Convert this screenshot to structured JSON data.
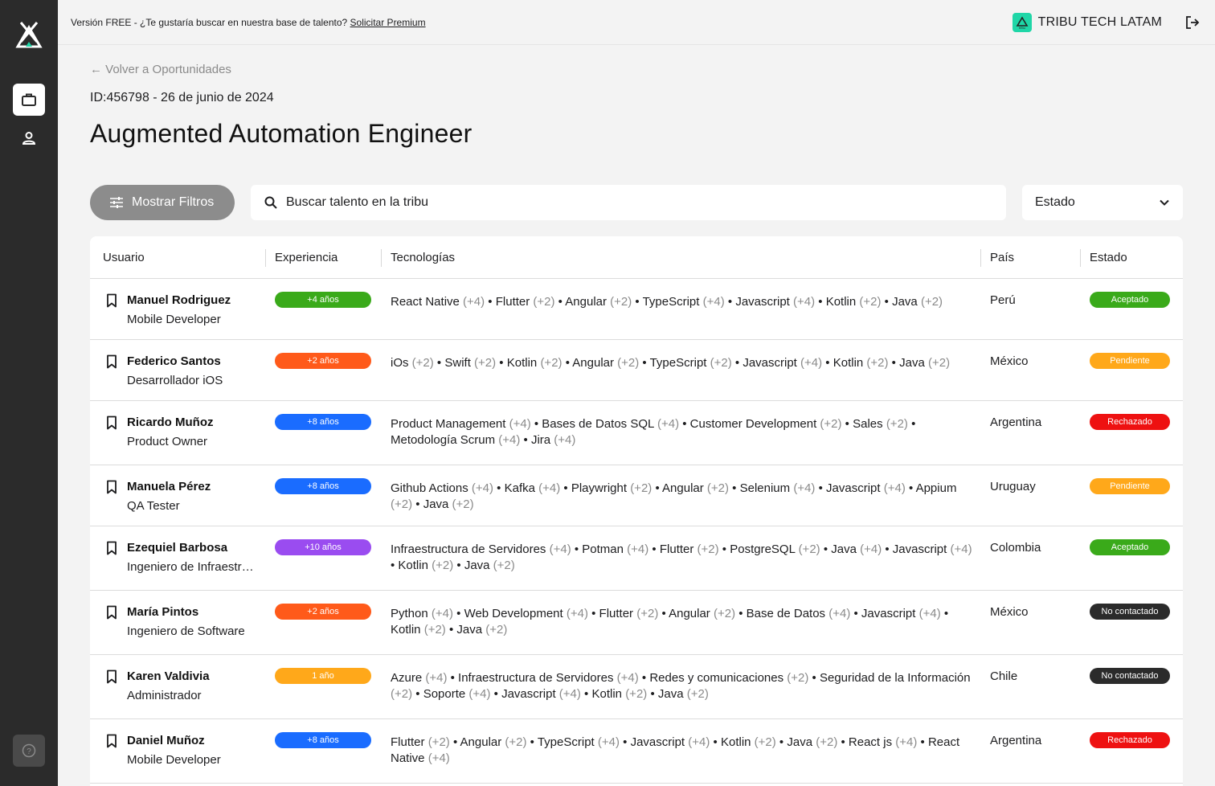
{
  "topbar": {
    "free_text": "Versión FREE - ¿Te gustaría buscar en nuestra base de talento?",
    "premium_link": "Solicitar Premium",
    "company": "TRIBU TECH LATAM",
    "brand_logo_text": "tribu"
  },
  "page": {
    "back_label": "← Volver a Oportunidades",
    "job_id": "ID:456798 - 26 de junio de 2024",
    "title": "Augmented Automation Engineer"
  },
  "toolbar": {
    "filter_label": "Mostrar Filtros",
    "search_placeholder": "Buscar talento en la tribu",
    "status_select": "Estado"
  },
  "table": {
    "headers": [
      "Usuario",
      "Experiencia",
      "Tecnologías",
      "País",
      "Estado"
    ],
    "rows": [
      {
        "name": "Manuel Rodriguez",
        "role": "Mobile Developer",
        "experience": "+4 años",
        "country": "Perú",
        "status": "Aceptado",
        "techs": [
          [
            "React Native",
            "(+4)"
          ],
          [
            "Flutter",
            "(+2)"
          ],
          [
            "Angular",
            "(+2)"
          ],
          [
            "TypeScript",
            "(+4)"
          ],
          [
            "Javascript",
            "(+4)"
          ],
          [
            "Kotlin",
            "(+2)"
          ],
          [
            "Java",
            "(+2)"
          ]
        ]
      },
      {
        "name": "Federico Santos",
        "role": "Desarrollador iOS",
        "experience": "+2 años",
        "country": "México",
        "status": "Pendiente",
        "techs": [
          [
            "iOs",
            "(+2)"
          ],
          [
            "Swift",
            "(+2)"
          ],
          [
            "Kotlin",
            "(+2)"
          ],
          [
            "Angular",
            "(+2)"
          ],
          [
            "TypeScript",
            "(+2)"
          ],
          [
            "Javascript",
            "(+4)"
          ],
          [
            "Kotlin",
            "(+2)"
          ],
          [
            "Java",
            "(+2)"
          ]
        ]
      },
      {
        "name": "Ricardo Muñoz",
        "role": "Product Owner",
        "experience": "+8 años",
        "country": "Argentina",
        "status": "Rechazado",
        "techs": [
          [
            "Product Management",
            "(+4)"
          ],
          [
            "Bases de Datos SQL",
            "(+4)"
          ],
          [
            "Customer Development",
            "(+2)"
          ],
          [
            "Sales",
            "(+2)"
          ],
          [
            "Metodología Scrum",
            "(+4)"
          ],
          [
            "Jira",
            "(+4)"
          ]
        ]
      },
      {
        "name": "Manuela Pérez",
        "role": "QA Tester",
        "experience": "+8 años",
        "country": "Uruguay",
        "status": "Pendiente",
        "techs": [
          [
            "Github Actions",
            "(+4)"
          ],
          [
            "Kafka",
            "(+4)"
          ],
          [
            "Playwright",
            "(+2)"
          ],
          [
            "Angular",
            "(+2)"
          ],
          [
            "Selenium",
            "(+4)"
          ],
          [
            "Javascript",
            "(+4)"
          ],
          [
            "Appium",
            "(+2)"
          ],
          [
            "Java",
            "(+2)"
          ]
        ]
      },
      {
        "name": "Ezequiel Barbosa",
        "role": "Ingeniero de Infraestructura",
        "experience": "+10 años",
        "country": "Colombia",
        "status": "Aceptado",
        "techs": [
          [
            "Infraestructura de Servidores",
            "(+4)"
          ],
          [
            "Potman",
            "(+4)"
          ],
          [
            "Flutter",
            "(+2)"
          ],
          [
            "PostgreSQL",
            "(+2)"
          ],
          [
            "Java",
            "(+4)"
          ],
          [
            "Javascript",
            "(+4)"
          ],
          [
            "Kotlin",
            "(+2)"
          ],
          [
            "Java",
            "(+2)"
          ]
        ]
      },
      {
        "name": "María Pintos",
        "role": "Ingeniero de Software",
        "experience": "+2 años",
        "country": "México",
        "status": "No contactado",
        "techs": [
          [
            "Python",
            "(+4)"
          ],
          [
            "Web Development",
            "(+4)"
          ],
          [
            "Flutter",
            "(+2)"
          ],
          [
            "Angular",
            "(+2)"
          ],
          [
            "Base de Datos",
            "(+4)"
          ],
          [
            "Javascript",
            "(+4)"
          ],
          [
            "Kotlin",
            "(+2)"
          ],
          [
            "Java",
            "(+2)"
          ]
        ]
      },
      {
        "name": "Karen Valdivia",
        "role": "Administrador",
        "experience": "1 año",
        "country": "Chile",
        "status": "No contactado",
        "techs": [
          [
            "Azure",
            "(+4)"
          ],
          [
            "Infraestructura de Servidores",
            "(+4)"
          ],
          [
            "Redes y comunicaciones",
            "(+2)"
          ],
          [
            "Seguridad de la Información",
            "(+2)"
          ],
          [
            "Soporte",
            "(+4)"
          ],
          [
            "Javascript",
            "(+4)"
          ],
          [
            "Kotlin",
            "(+2)"
          ],
          [
            "Java",
            "(+2)"
          ]
        ]
      },
      {
        "name": "Daniel Muñoz",
        "role": "Mobile Developer",
        "experience": "+8 años",
        "country": "Argentina",
        "status": "Rechazado",
        "techs": [
          [
            "Flutter",
            "(+2)"
          ],
          [
            "Angular",
            "(+2)"
          ],
          [
            "TypeScript",
            "(+4)"
          ],
          [
            "Javascript",
            "(+4)"
          ],
          [
            "Kotlin",
            "(+2)"
          ],
          [
            "Java",
            "(+2)"
          ],
          [
            "React js",
            "(+4)"
          ],
          [
            "React Native",
            "(+4)"
          ]
        ]
      }
    ]
  },
  "colors": {
    "experience": {
      "+4 años": "#3aaa1a",
      "+2 años": "#ff5a1a",
      "+8 años": "#1a6cff",
      "+10 años": "#9a4cf0",
      "1 año": "#ffa81a"
    },
    "status": {
      "Aceptado": "#3aaa1a",
      "Pendiente": "#ffa81a",
      "Rechazado": "#ee1111",
      "No contactado": "#2b2b2b"
    }
  }
}
